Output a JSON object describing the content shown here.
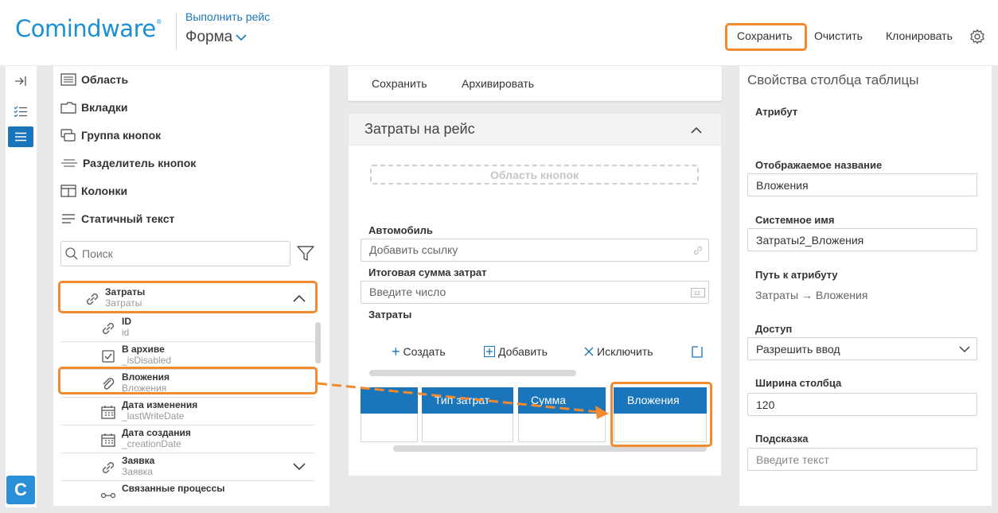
{
  "header": {
    "logo": "Comindware",
    "app_link": "Выполнить рейс",
    "form_title": "Форма",
    "buttons": {
      "save": "Сохранить",
      "clear": "Очистить",
      "clone": "Клонировать"
    },
    "accent_color": "#1a75bb",
    "highlight_color": "#f28b30"
  },
  "left_rail": {
    "icons": [
      "collapse-icon",
      "checklist-icon",
      "list-icon"
    ],
    "app_badge": "C"
  },
  "toolbox": {
    "items": [
      {
        "label": "Область",
        "icon": "area-icon"
      },
      {
        "label": "Вкладки",
        "icon": "tabs-icon"
      },
      {
        "label": "Группа кнопок",
        "icon": "button-group-icon"
      },
      {
        "label": "Разделитель кнопок",
        "icon": "separator-icon"
      },
      {
        "label": "Колонки",
        "icon": "columns-icon"
      },
      {
        "label": "Статичный текст",
        "icon": "text-icon"
      }
    ],
    "search_placeholder": "Поиск",
    "tree": {
      "group": {
        "title": "Затраты",
        "subtitle": "Затраты"
      },
      "rows": [
        {
          "title": "ID",
          "subtitle": "id",
          "icon": "link-icon"
        },
        {
          "title": "В архиве",
          "subtitle": "_isDisabled",
          "icon": "checkbox-icon"
        },
        {
          "title": "Вложения",
          "subtitle": "Вложения",
          "icon": "paperclip-icon"
        },
        {
          "title": "Дата изменения",
          "subtitle": "_lastWriteDate",
          "icon": "calendar-icon"
        },
        {
          "title": "Дата создания",
          "subtitle": "_creationDate",
          "icon": "calendar-icon"
        },
        {
          "title": "Заявка",
          "subtitle": "Заявка",
          "icon": "link-icon"
        },
        {
          "title": "Связанные процессы",
          "subtitle": "",
          "icon": "process-icon"
        }
      ]
    }
  },
  "center": {
    "toolbar": {
      "save": "Сохранить",
      "archive": "Архивировать"
    },
    "section_title": "Затраты на рейс",
    "button_area": "Область кнопок",
    "fields": [
      {
        "label": "Автомобиль",
        "placeholder": "Добавить ссылку"
      },
      {
        "label": "Итоговая сумма затрат",
        "placeholder": "Введите число"
      }
    ],
    "table_label": "Затраты",
    "actions": {
      "create": "Создать",
      "add": "Добавить",
      "exclude": "Исключить"
    },
    "columns": [
      "Тип затрат",
      "Сумма",
      "Вложения"
    ]
  },
  "properties": {
    "title": "Свойства столбца таблицы",
    "attribute_label": "Атрибут",
    "display_name_label": "Отображаемое название",
    "display_name_value": "Вложения",
    "system_name_label": "Системное имя",
    "system_name_value": "Затраты2_Вложения",
    "path_label": "Путь к атрибуту",
    "path_value": "Затраты → Вложения",
    "access_label": "Доступ",
    "access_value": "Разрешить ввод",
    "width_label": "Ширина столбца",
    "width_value": "120",
    "hint_label": "Подсказка",
    "hint_placeholder": "Введите текст"
  }
}
